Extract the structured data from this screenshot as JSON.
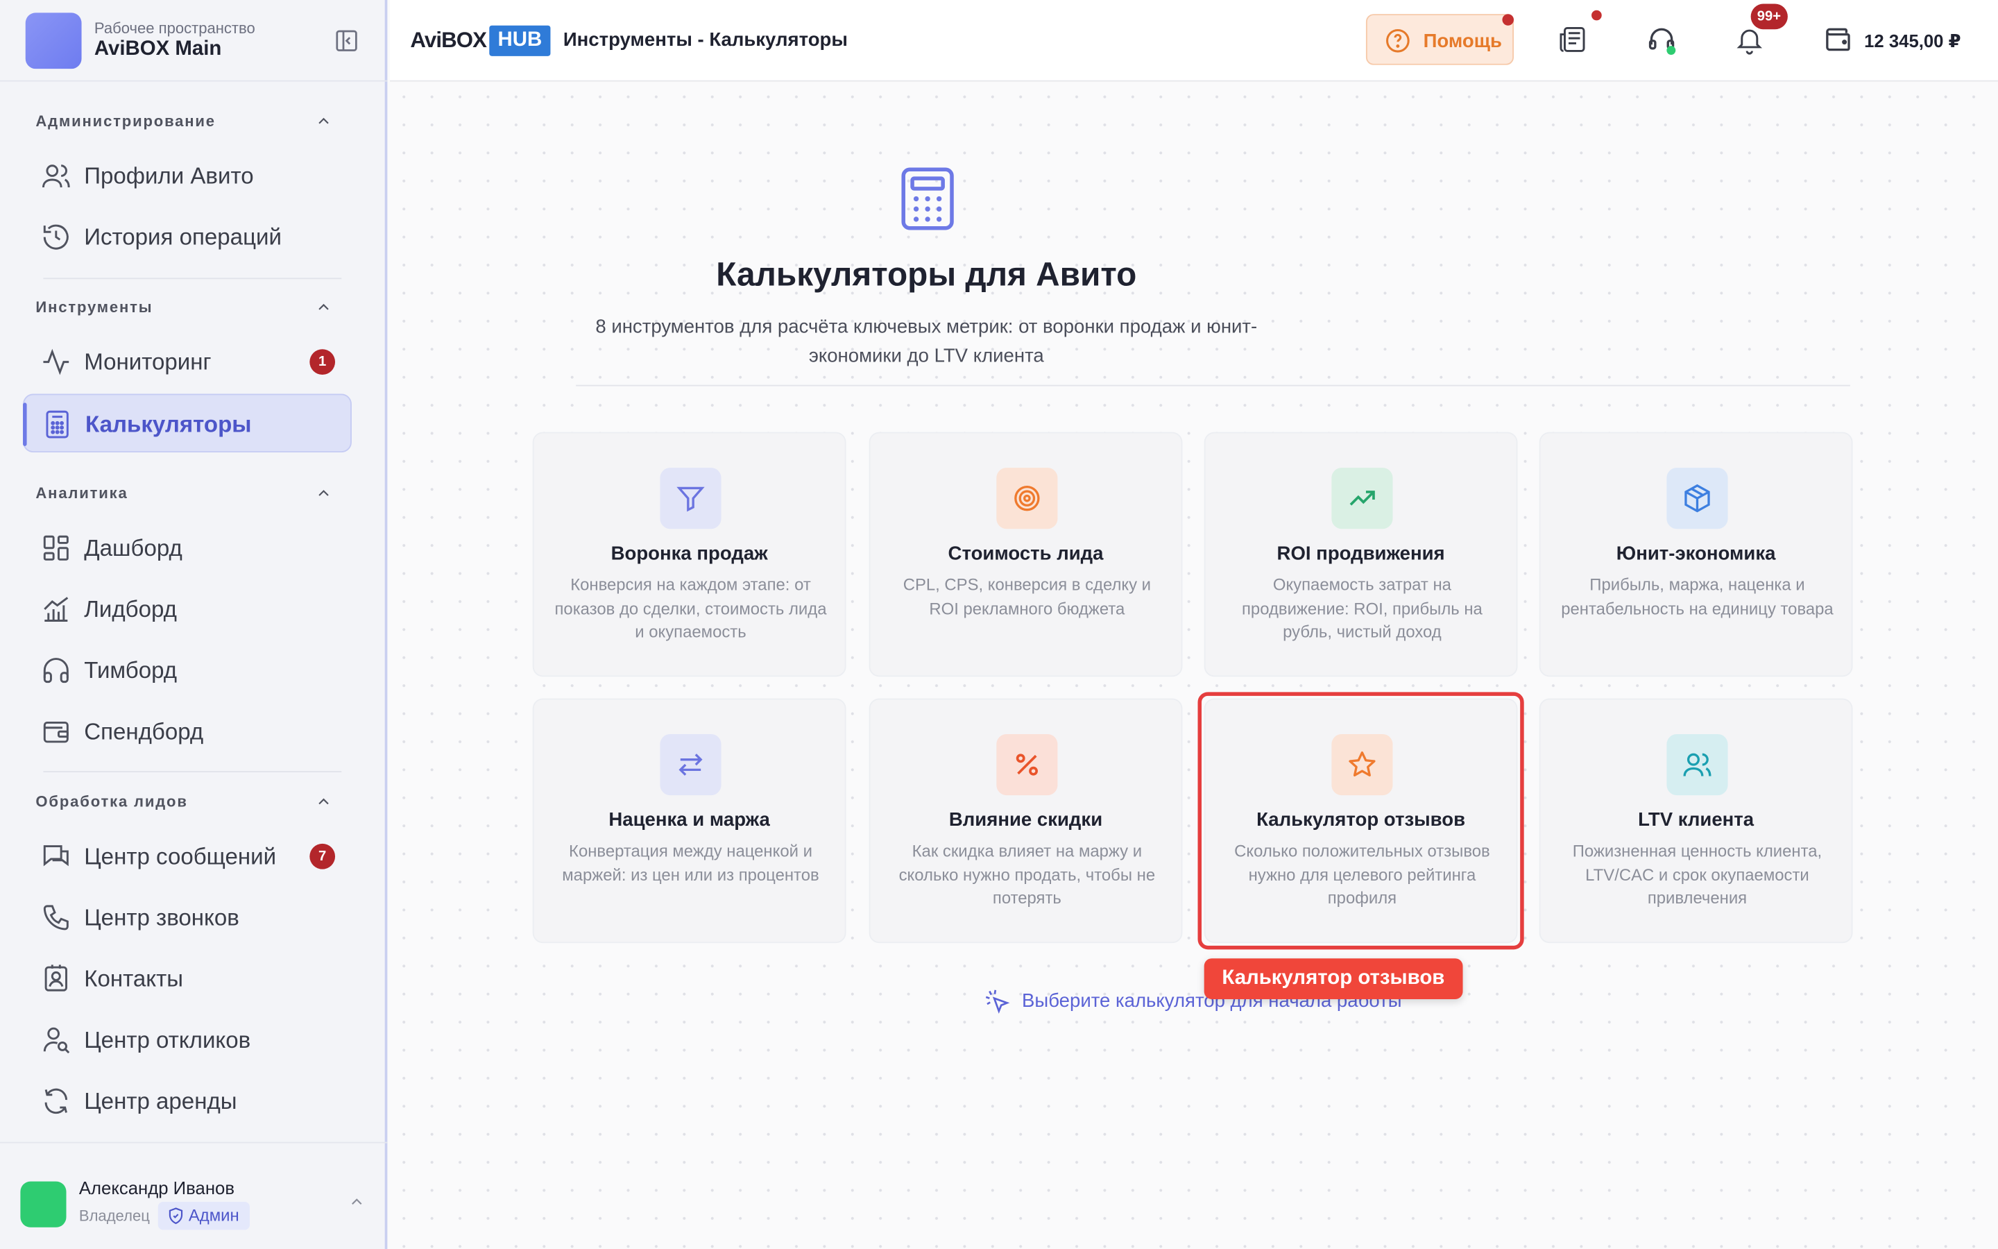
{
  "workspace": {
    "subtitle": "Рабочее пространство",
    "name": "AviBOX Main"
  },
  "sidebar": {
    "sections": [
      {
        "title": "Администрирование",
        "items": [
          {
            "label": "Профили Авито",
            "icon": "users-icon"
          },
          {
            "label": "История операций",
            "icon": "history-icon"
          }
        ]
      },
      {
        "title": "Инструменты",
        "items": [
          {
            "label": "Мониторинг",
            "icon": "activity-icon",
            "badge": "1"
          },
          {
            "label": "Калькуляторы",
            "icon": "calculator-icon",
            "active": true
          }
        ]
      },
      {
        "title": "Аналитика",
        "items": [
          {
            "label": "Дашборд",
            "icon": "dashboard-icon"
          },
          {
            "label": "Лидборд",
            "icon": "chart-icon"
          },
          {
            "label": "Тимборд",
            "icon": "headphones-icon"
          },
          {
            "label": "Спендборд",
            "icon": "wallet-icon"
          }
        ]
      },
      {
        "title": "Обработка лидов",
        "items": [
          {
            "label": "Центр сообщений",
            "icon": "messages-icon",
            "badge": "7"
          },
          {
            "label": "Центр звонков",
            "icon": "phone-icon"
          },
          {
            "label": "Контакты",
            "icon": "contacts-icon"
          },
          {
            "label": "Центр откликов",
            "icon": "user-search-icon"
          },
          {
            "label": "Центр аренды",
            "icon": "refresh-icon"
          }
        ]
      }
    ]
  },
  "user": {
    "name": "Александр Иванов",
    "role": "Владелец",
    "badge": "Админ"
  },
  "header": {
    "logo_text": "AviBOX",
    "logo_badge": "HUB",
    "breadcrumb": "Инструменты - Калькуляторы",
    "help_label": "Помощь",
    "notifications_badge": "99+",
    "balance": "12 345,00 ₽"
  },
  "main": {
    "title": "Калькуляторы для Авито",
    "subtitle": "8 инструментов для расчёта ключевых метрик: от воронки продаж и юнит-экономики до LTV клиента",
    "hint": "Выберите калькулятор для начала работы",
    "tooltip": "Калькулятор отзывов",
    "cards": [
      {
        "title": "Воронка продаж",
        "desc": "Конверсия на каждом этапе: от показов до сделки, стоимость лида и окупаемость",
        "icon": "filter-icon",
        "color": "#6b74e0",
        "bg": "#e2e5f8"
      },
      {
        "title": "Стоимость лида",
        "desc": "CPL, CPS, конверсия в сделку и ROI рекламного бюджета",
        "icon": "target-icon",
        "color": "#ef7a2e",
        "bg": "#fbe3d6"
      },
      {
        "title": "ROI продвижения",
        "desc": "Окупаемость затрат на продвижение: ROI, прибыль на рубль, чистый доход",
        "icon": "trending-up-icon",
        "color": "#26a56b",
        "bg": "#daf0e4"
      },
      {
        "title": "Юнит-экономика",
        "desc": "Прибыль, маржа, наценка и рентабельность на единицу товара",
        "icon": "box-icon",
        "color": "#3d7fe0",
        "bg": "#dde8f8"
      },
      {
        "title": "Наценка и маржа",
        "desc": "Конвертация между наценкой и маржей: из цен или из процентов",
        "icon": "arrows-icon",
        "color": "#6b74e0",
        "bg": "#e2e5f8"
      },
      {
        "title": "Влияние скидки",
        "desc": "Как скидка влияет на маржу и сколько нужно продать, чтобы не потерять",
        "icon": "percent-icon",
        "color": "#e9542a",
        "bg": "#fbe0d8"
      },
      {
        "title": "Калькулятор отзывов",
        "desc": "Сколько положительных отзывов нужно для целевого рейтинга профиля",
        "icon": "star-icon",
        "color": "#ef7a2e",
        "bg": "#fbe3d6"
      },
      {
        "title": "LTV клиента",
        "desc": "Пожизненная ценность клиента, LTV/CAC и срок окупаемости привлечения",
        "icon": "users-icon",
        "color": "#1a9fb0",
        "bg": "#d6eef1"
      }
    ]
  }
}
